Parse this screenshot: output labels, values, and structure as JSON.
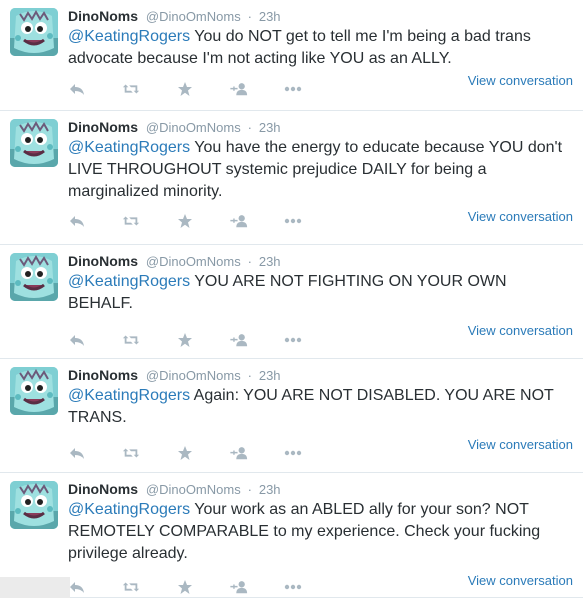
{
  "tweets": [
    {
      "name": "DinoNoms",
      "handle": "@DinoOmNoms",
      "separator": "·",
      "time": "23h",
      "mention": "@KeatingRogers",
      "text": " You do NOT get to tell me I'm being a bad trans advocate because I'm not acting like YOU as an ALLY.",
      "view_label": "View conversation"
    },
    {
      "name": "DinoNoms",
      "handle": "@DinoOmNoms",
      "separator": "·",
      "time": "23h",
      "mention": "@KeatingRogers",
      "text": " You have the energy to educate because YOU don't LIVE THROUGHOUT systemic prejudice DAILY for being a marginalized minority.",
      "view_label": "View conversation"
    },
    {
      "name": "DinoNoms",
      "handle": "@DinoOmNoms",
      "separator": "·",
      "time": "23h",
      "mention": "@KeatingRogers",
      "text": " YOU ARE NOT FIGHTING ON YOUR OWN BEHALF.",
      "view_label": "View conversation"
    },
    {
      "name": "DinoNoms",
      "handle": "@DinoOmNoms",
      "separator": "·",
      "time": "23h",
      "mention": "@KeatingRogers",
      "text": " Again: YOU ARE NOT DISABLED. YOU ARE NOT TRANS.",
      "view_label": "View conversation"
    },
    {
      "name": "DinoNoms",
      "handle": "@DinoOmNoms",
      "separator": "·",
      "time": "23h",
      "mention": "@KeatingRogers",
      "text": " Your work as an ABLED ally for your son? NOT REMOTELY COMPARABLE to my experience. Check your fucking privilege already.",
      "view_label": "View conversation"
    }
  ],
  "icons": [
    "reply-icon",
    "retweet-icon",
    "favorite-icon",
    "follow-icon",
    "more-icon"
  ],
  "colors": {
    "link": "#2b7bb9",
    "muted": "#8899a6",
    "action_icon": "#aab8c2",
    "text": "#292f33"
  }
}
